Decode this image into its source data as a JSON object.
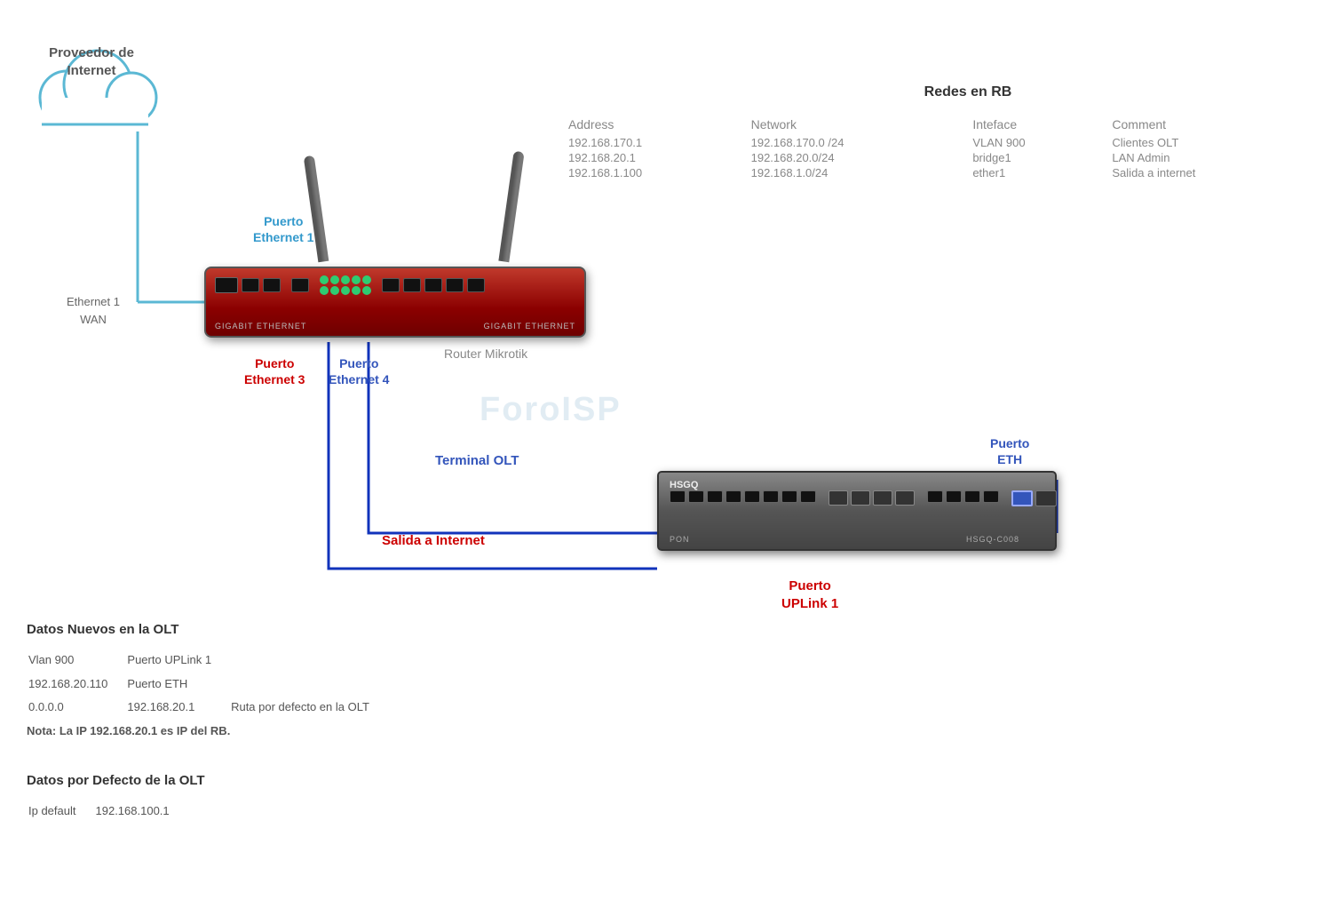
{
  "cloud": {
    "label_line1": "Proveedor de",
    "label_line2": "Internet"
  },
  "redes_rb": {
    "title": "Redes en RB",
    "headers": [
      "Address",
      "Network",
      "Inteface",
      "Comment"
    ],
    "rows": [
      [
        "192.168.170.1",
        "192.168.170.0 /24",
        "VLAN 900",
        "Clientes OLT"
      ],
      [
        "192.168.20.1",
        "192.168.20.0/24",
        "bridge1",
        "LAN Admin"
      ],
      [
        "192.168.1.100",
        "192.168.1.0/24",
        "ether1",
        "Salida a internet"
      ]
    ]
  },
  "labels": {
    "ethernet1_wan_line1": "Ethernet 1",
    "ethernet1_wan_line2": "WAN",
    "puerto_eth1_line1": "Puerto",
    "puerto_eth1_line2": "Ethernet 1",
    "puerto_eth3_line1": "Puerto",
    "puerto_eth3_line2": "Ethernet 3",
    "puerto_eth4_line1": "Puerto",
    "puerto_eth4_line2": "Ethernet 4",
    "router_label": "Router Mikrotik",
    "terminal_olt": "Terminal OLT",
    "salida_internet": "Salida a Internet",
    "puerto_eth_olt_line1": "Puerto",
    "puerto_eth_olt_line2": "ETH",
    "puerto_uplink1_line1": "Puerto",
    "puerto_uplink1_line2": "UPLink 1",
    "foroISP": "ForoISP"
  },
  "olt_device": {
    "brand": "HSGQ"
  },
  "bottom": {
    "section1_title": "Datos Nuevos en  la OLT",
    "rows1": [
      {
        "col1": "Vlan 900",
        "col2": "Puerto UPLink 1",
        "col3": ""
      },
      {
        "col1": "192.168.20.110",
        "col2": "Puerto ETH",
        "col3": ""
      },
      {
        "col1": "0.0.0.0",
        "col2": "192.168.20.1",
        "col3": "Ruta  por defecto en la OLT"
      }
    ],
    "nota": "Nota: La IP 192.168.20.1 es IP del RB.",
    "section2_title": "Datos por Defecto de la OLT",
    "rows2": [
      {
        "col1": "Ip default",
        "col2": "192.168.100.1"
      }
    ]
  }
}
